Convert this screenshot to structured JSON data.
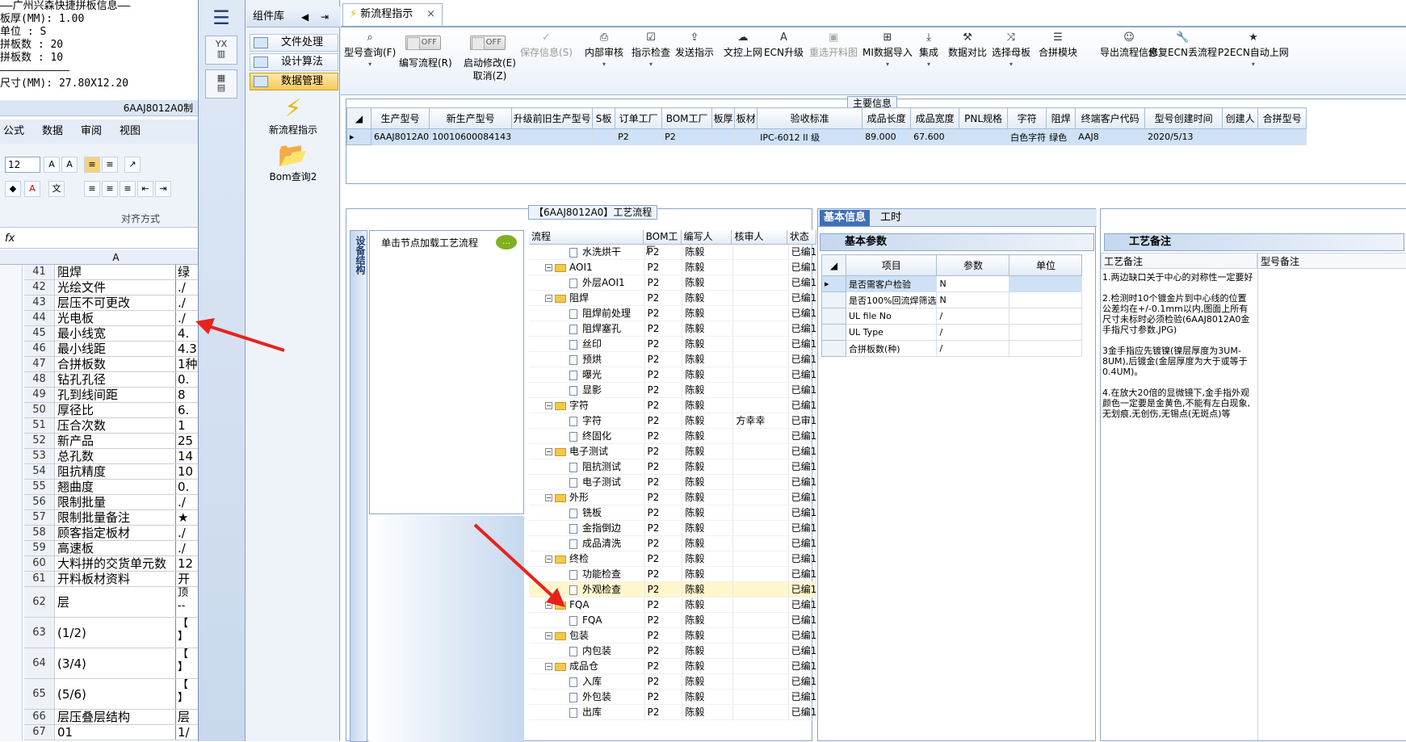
{
  "excel": {
    "notes": [
      "——广州兴森快捷拼板信息——",
      "板厚(MM): 1.00",
      "单位 : S",
      "拼板数 : 20",
      "拼板数 : 10",
      "———————————",
      "尺寸(MM): 27.80X12.20"
    ],
    "window_title": "6AAJ8012A0制",
    "menu": [
      "公式",
      "数据",
      "审阅",
      "视图"
    ],
    "font_size": "12",
    "group_label": "对齐方式",
    "fx": "fx",
    "col_header": "A",
    "rows": [
      {
        "n": "41",
        "c": "阻焊",
        "d": "绿"
      },
      {
        "n": "42",
        "c": "光绘文件",
        "d": "./"
      },
      {
        "n": "43",
        "c": "层压不可更改",
        "d": "./"
      },
      {
        "n": "44",
        "c": "光电板",
        "d": "./"
      },
      {
        "n": "45",
        "c": "最小线宽",
        "d": "4."
      },
      {
        "n": "46",
        "c": "最小线距",
        "d": "4.3"
      },
      {
        "n": "47",
        "c": "合拼板数",
        "d": "1种"
      },
      {
        "n": "48",
        "c": "钻孔孔径",
        "d": "0."
      },
      {
        "n": "49",
        "c": "孔到线间距",
        "d": "8"
      },
      {
        "n": "50",
        "c": "厚径比",
        "d": "6."
      },
      {
        "n": "51",
        "c": "压合次数",
        "d": "1"
      },
      {
        "n": "52",
        "c": "新产品",
        "d": "25"
      },
      {
        "n": "53",
        "c": "总孔数",
        "d": "14"
      },
      {
        "n": "54",
        "c": "阻抗精度",
        "d": "10"
      },
      {
        "n": "55",
        "c": "翘曲度",
        "d": "0."
      },
      {
        "n": "56",
        "c": "限制批量",
        "d": "./"
      },
      {
        "n": "57",
        "c": "限制批量备注",
        "d": "★"
      },
      {
        "n": "58",
        "c": "顾客指定板材",
        "d": "./"
      },
      {
        "n": "59",
        "c": "高速板",
        "d": "./"
      },
      {
        "n": "60",
        "c": "大料拼的交货单元数",
        "d": "12"
      },
      {
        "n": "61",
        "c": "开料板材资料",
        "d": "开"
      },
      {
        "n": "62",
        "c": "层",
        "d": "顶\n--"
      },
      {
        "n": "63",
        "c": "(1/2)",
        "d": "【\n】"
      },
      {
        "n": "64",
        "c": "(3/4)",
        "d": "【\n】"
      },
      {
        "n": "65",
        "c": "(5/6)",
        "d": "【\n】"
      },
      {
        "n": "66",
        "c": "层压叠层结构",
        "d": "层"
      },
      {
        "n": "67",
        "c": "01",
        "d": "1/"
      }
    ]
  },
  "sidebar": {
    "component_lib": "组件库",
    "items": [
      "文件处理",
      "设计算法",
      "数据管理"
    ],
    "big_items": [
      "新流程指示",
      "Bom查询2"
    ],
    "icon1": "YX",
    "icon2": "▦"
  },
  "tab": {
    "label": "新流程指示",
    "close": "×"
  },
  "toolbar": {
    "buttons": [
      {
        "label": "型号查询(F)",
        "icon": "⌕",
        "dd": "▾"
      },
      {
        "label": "保存信息(S)",
        "icon": "✓",
        "dis": true
      },
      {
        "label": "内部审核",
        "icon": "⎙",
        "dd": "▾"
      },
      {
        "label": "指示检查",
        "icon": "☑",
        "dd": "▾"
      },
      {
        "label": "发送指示",
        "icon": "⇪"
      },
      {
        "label": "文控上网",
        "icon": "☁"
      },
      {
        "label": "ECN升级",
        "icon": "A"
      },
      {
        "label": "重选开料图",
        "icon": "▣",
        "dis": true
      },
      {
        "label": "MI数据导入",
        "icon": "⊞",
        "dd": "▾"
      },
      {
        "label": "集成",
        "icon": "⤓",
        "dd": "▾"
      },
      {
        "label": "数据对比",
        "icon": "⚒"
      },
      {
        "label": "选择母板",
        "icon": "⤨",
        "dd": "▾"
      },
      {
        "label": "合拼模块",
        "icon": "☰"
      },
      {
        "label": "导出流程信息",
        "icon": "☺"
      },
      {
        "label": "修复ECN丢流程",
        "icon": "🔧"
      },
      {
        "label": "P2ECN自动上网",
        "icon": "★",
        "dd": "▾"
      }
    ],
    "toggle1": {
      "state": "OFF",
      "label": "编写流程(R)"
    },
    "toggle2": {
      "state": "OFF",
      "label": "启动修改(E)",
      "label2": "取消(Z)"
    }
  },
  "main_info": {
    "caption": "主要信息",
    "headers": [
      "生产型号",
      "新生产型号",
      "升级前旧生产型号",
      "S板",
      "订单工厂",
      "BOM工厂",
      "板厚",
      "板材",
      "验收标准",
      "成品长度",
      "成品宽度",
      "PNL规格",
      "字符",
      "阻焊",
      "终端客户代码",
      "型号创建时间",
      "创建人",
      "合拼型号"
    ],
    "row": [
      "6AAJ8012A0",
      "10010600084143",
      "",
      "",
      "P2",
      "P2",
      "",
      "",
      "IPC-6012 II 级",
      "89.000",
      "67.600",
      "",
      "白色字符",
      "绿色",
      "AAJ8",
      "2020/5/13",
      "",
      ""
    ]
  },
  "process": {
    "caption": "【6AAJ8012A0】工艺流程",
    "vtab": "设备结构",
    "node_hint": "单击节点加载工艺流程",
    "headers": [
      "流程",
      "BOM工厂",
      "编写人",
      "核审人",
      "状态"
    ],
    "rows": [
      {
        "lvl": 2,
        "name": "水洗烘干",
        "bom": "P2",
        "w": "陈毅",
        "r": "",
        "s": "已编1"
      },
      {
        "lvl": 1,
        "name": "AOI1",
        "bom": "P2",
        "w": "陈毅",
        "r": "",
        "s": "已编1"
      },
      {
        "lvl": 2,
        "name": "外层AOI1",
        "bom": "P2",
        "w": "陈毅",
        "r": "",
        "s": "已编1"
      },
      {
        "lvl": 1,
        "name": "阻焊",
        "bom": "P2",
        "w": "陈毅",
        "r": "",
        "s": "已编1"
      },
      {
        "lvl": 2,
        "name": "阻焊前处理",
        "bom": "P2",
        "w": "陈毅",
        "r": "",
        "s": "已编1"
      },
      {
        "lvl": 2,
        "name": "阻焊塞孔",
        "bom": "P2",
        "w": "陈毅",
        "r": "",
        "s": "已编1"
      },
      {
        "lvl": 2,
        "name": "丝印",
        "bom": "P2",
        "w": "陈毅",
        "r": "",
        "s": "已编1"
      },
      {
        "lvl": 2,
        "name": "预烘",
        "bom": "P2",
        "w": "陈毅",
        "r": "",
        "s": "已编1"
      },
      {
        "lvl": 2,
        "name": "曝光",
        "bom": "P2",
        "w": "陈毅",
        "r": "",
        "s": "已编1"
      },
      {
        "lvl": 2,
        "name": "显影",
        "bom": "P2",
        "w": "陈毅",
        "r": "",
        "s": "已编1"
      },
      {
        "lvl": 1,
        "name": "字符",
        "bom": "P2",
        "w": "陈毅",
        "r": "",
        "s": "已编1"
      },
      {
        "lvl": 2,
        "name": "字符",
        "bom": "P2",
        "w": "陈毅",
        "r": "方幸幸",
        "s": "已审1"
      },
      {
        "lvl": 2,
        "name": "终固化",
        "bom": "P2",
        "w": "陈毅",
        "r": "",
        "s": "已编1"
      },
      {
        "lvl": 1,
        "name": "电子测试",
        "bom": "P2",
        "w": "陈毅",
        "r": "",
        "s": "已编1"
      },
      {
        "lvl": 2,
        "name": "阻抗测试",
        "bom": "P2",
        "w": "陈毅",
        "r": "",
        "s": "已编1"
      },
      {
        "lvl": 2,
        "name": "电子测试",
        "bom": "P2",
        "w": "陈毅",
        "r": "",
        "s": "已编1"
      },
      {
        "lvl": 1,
        "name": "外形",
        "bom": "P2",
        "w": "陈毅",
        "r": "",
        "s": "已编1"
      },
      {
        "lvl": 2,
        "name": "铣板",
        "bom": "P2",
        "w": "陈毅",
        "r": "",
        "s": "已编1"
      },
      {
        "lvl": 2,
        "name": "金指倒边",
        "bom": "P2",
        "w": "陈毅",
        "r": "",
        "s": "已编1"
      },
      {
        "lvl": 2,
        "name": "成品清洗",
        "bom": "P2",
        "w": "陈毅",
        "r": "",
        "s": "已编1"
      },
      {
        "lvl": 1,
        "name": "终检",
        "bom": "P2",
        "w": "陈毅",
        "r": "",
        "s": "已编1"
      },
      {
        "lvl": 2,
        "name": "功能检查",
        "bom": "P2",
        "w": "陈毅",
        "r": "",
        "s": "已编1"
      },
      {
        "lvl": 2,
        "name": "外观检查",
        "bom": "P2",
        "w": "陈毅",
        "r": "",
        "s": "已编1",
        "sel": true
      },
      {
        "lvl": 1,
        "name": "FQA",
        "bom": "P2",
        "w": "陈毅",
        "r": "",
        "s": "已编1"
      },
      {
        "lvl": 2,
        "name": "FQA",
        "bom": "P2",
        "w": "陈毅",
        "r": "",
        "s": "已编1"
      },
      {
        "lvl": 1,
        "name": "包装",
        "bom": "P2",
        "w": "陈毅",
        "r": "",
        "s": "已编1"
      },
      {
        "lvl": 2,
        "name": "内包装",
        "bom": "P2",
        "w": "陈毅",
        "r": "",
        "s": "已编1"
      },
      {
        "lvl": 1,
        "name": "成品仓",
        "bom": "P2",
        "w": "陈毅",
        "r": "",
        "s": "已编1"
      },
      {
        "lvl": 2,
        "name": "入库",
        "bom": "P2",
        "w": "陈毅",
        "r": "",
        "s": "已编1"
      },
      {
        "lvl": 2,
        "name": "外包装",
        "bom": "P2",
        "w": "陈毅",
        "r": "",
        "s": "已编1"
      },
      {
        "lvl": 2,
        "name": "出库",
        "bom": "P2",
        "w": "陈毅",
        "r": "",
        "s": "已编1"
      }
    ]
  },
  "basic": {
    "tabs": [
      "基本信息",
      "工时"
    ],
    "sub": "基本参数",
    "headers": [
      "项目",
      "参数",
      "单位"
    ],
    "rows": [
      {
        "item": "是否需客户检验",
        "param": "N",
        "unit": ""
      },
      {
        "item": "是否100%回流焊筛选",
        "param": "N",
        "unit": ""
      },
      {
        "item": "UL file No",
        "param": "/",
        "unit": ""
      },
      {
        "item": "UL Type",
        "param": "/",
        "unit": ""
      },
      {
        "item": "合拼板数(种)",
        "param": "/",
        "unit": ""
      }
    ]
  },
  "note": {
    "sub": "工艺备注",
    "headers": [
      "工艺备注",
      "型号备注"
    ],
    "text": "1.两边缺口关于中心的对称性一定要好\n\n2.检测时10个镀金片到中心线的位置公差均在+/-0.1mm以内,图面上所有尺寸未标时必须检验(6AAJ8012A0金手指尺寸参数.JPG)\n\n3金手指应先镀镍(镍层厚度为3UM-8UM),后镀金(金层厚度为大于或等于0.4UM)。\n\n4.在放大20倍的显微镜下,金手指外观颜色一定要是金黄色,不能有左白现象,无划痕,无创伤,无锡点(无斑点)等"
  },
  "colors": {
    "accent": "#3f6fb6",
    "selected": "#cfe1f6",
    "folder": "#f5c948",
    "arrow": "#e8221b"
  }
}
